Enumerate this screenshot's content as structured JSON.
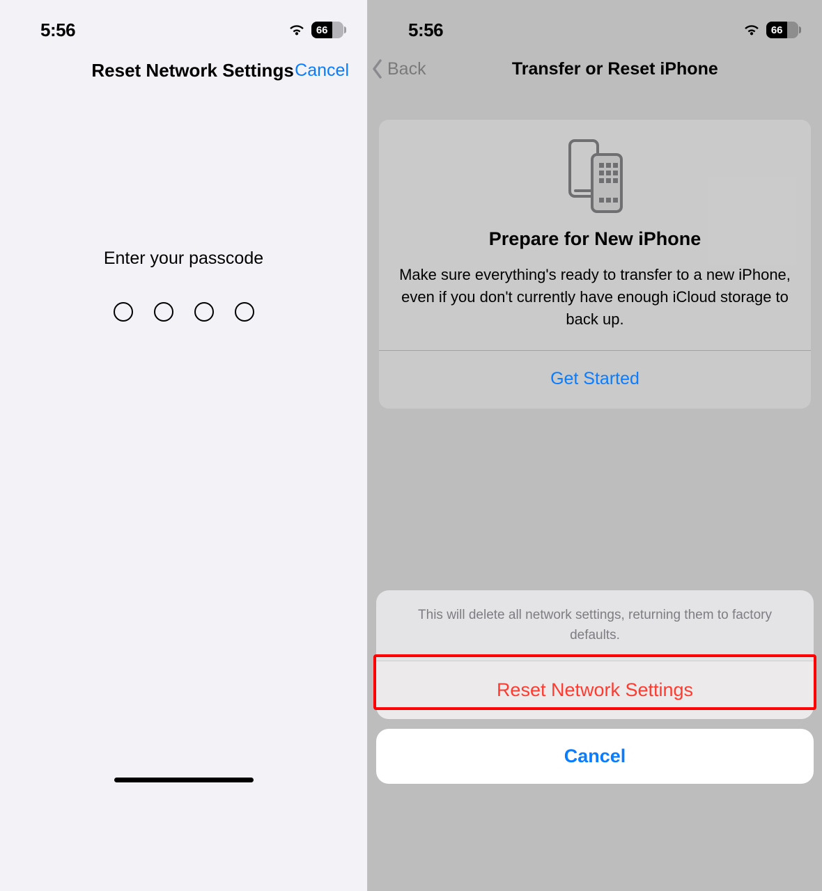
{
  "status": {
    "time": "5:56",
    "battery_percent": "66"
  },
  "left": {
    "title": "Reset Network Settings",
    "cancel": "Cancel",
    "prompt": "Enter your passcode"
  },
  "right": {
    "back": "Back",
    "title": "Transfer or Reset iPhone",
    "card": {
      "heading": "Prepare for New iPhone",
      "body": "Make sure everything's ready to transfer to a new iPhone, even if you don't currently have enough iCloud storage to back up.",
      "action": "Get Started"
    },
    "sheet": {
      "message": "This will delete all network settings, returning them to factory defaults.",
      "destructive": "Reset Network Settings",
      "cancel": "Cancel"
    }
  },
  "colors": {
    "link_blue": "#0a7cff",
    "destructive_red": "#ff3b30",
    "highlight_red": "#ff0000"
  }
}
